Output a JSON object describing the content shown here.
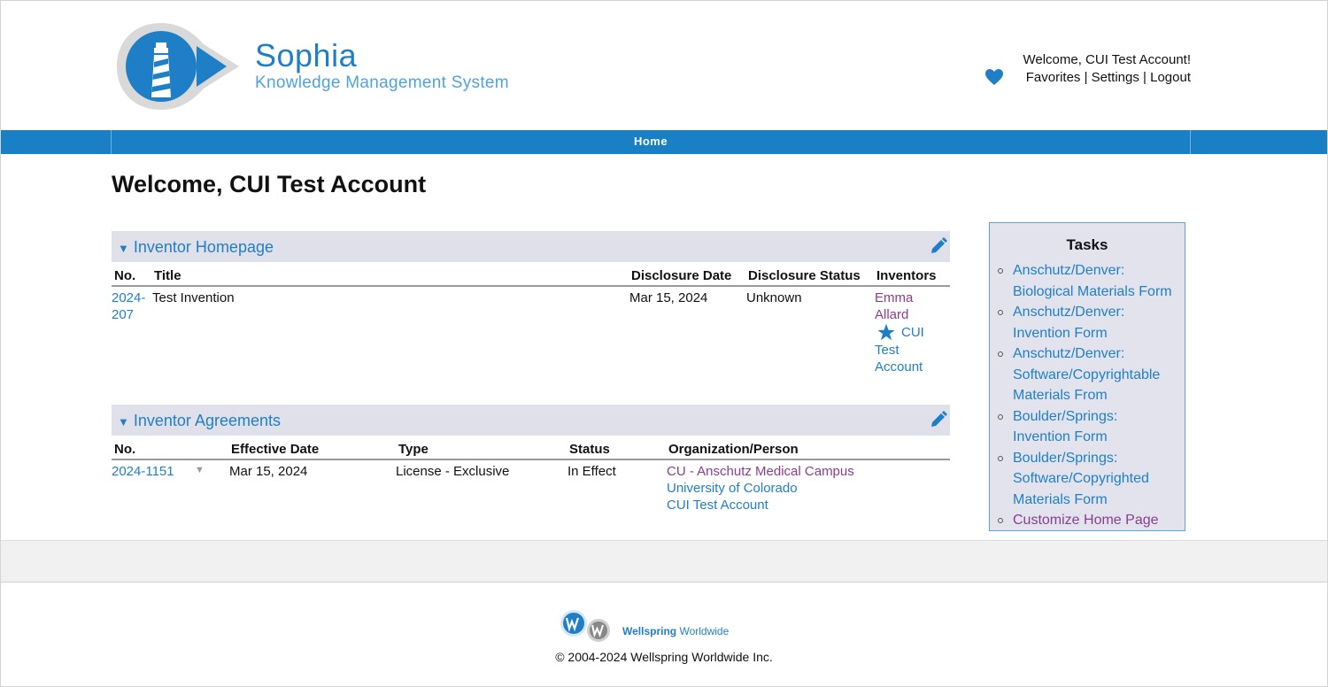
{
  "brand": {
    "name": "Sophia",
    "subtitle": "Knowledge Management System"
  },
  "user": {
    "welcome": "Welcome, CUI Test Account!",
    "links": [
      "Favorites",
      "Settings",
      "Logout"
    ],
    "separator": " | "
  },
  "nav": {
    "items": [
      "Home"
    ]
  },
  "page_title": "Welcome, CUI Test Account",
  "inventor_homepage": {
    "title": "Inventor Homepage",
    "columns": [
      "No.",
      "Title",
      "Disclosure Date",
      "Disclosure Status",
      "Inventors"
    ],
    "rows": [
      {
        "no_line1": "2024-",
        "no_line2": "207",
        "title": "Test Invention",
        "date": "Mar 15, 2024",
        "status": "Unknown",
        "inventors": {
          "first_line1": "Emma",
          "first_line2": "Allard",
          "second_line1": "CUI",
          "second_line2": "Test",
          "second_line3": "Account"
        }
      }
    ]
  },
  "inventor_agreements": {
    "title": "Inventor Agreements",
    "columns": [
      "No.",
      "Effective Date",
      "Type",
      "Status",
      "Organization/Person"
    ],
    "rows": [
      {
        "no": "2024-1151",
        "date": "Mar 15, 2024",
        "type": "License - Exclusive",
        "status": "In Effect",
        "org": [
          "CU - Anschutz Medical Campus",
          "University of Colorado",
          "CUI Test Account"
        ]
      }
    ]
  },
  "tasks": {
    "title": "Tasks",
    "items": [
      {
        "line1": "Anschutz/Denver:",
        "line2": "Biological Materials Form"
      },
      {
        "line1": "Anschutz/Denver:",
        "line2": "Invention Form"
      },
      {
        "line1": "Anschutz/Denver:",
        "line2": "Software/Copyrightable",
        "line3": "Materials From"
      },
      {
        "line1": "Boulder/Springs:",
        "line2": "Invention Form"
      },
      {
        "line1": "Boulder/Springs:",
        "line2": "Software/Copyrighted",
        "line3": "Materials Form"
      },
      {
        "line1": "Customize Home Page"
      }
    ]
  },
  "footer": {
    "vendor_bold": "Wellspring",
    "vendor_rest": " Worldwide",
    "copyright": "© 2004-2024 Wellspring Worldwide Inc."
  },
  "colors": {
    "accent": "#1a80c6",
    "link": "#1f7fc6",
    "visited": "#8a3d8f",
    "section_bg": "#dfe0ea"
  }
}
